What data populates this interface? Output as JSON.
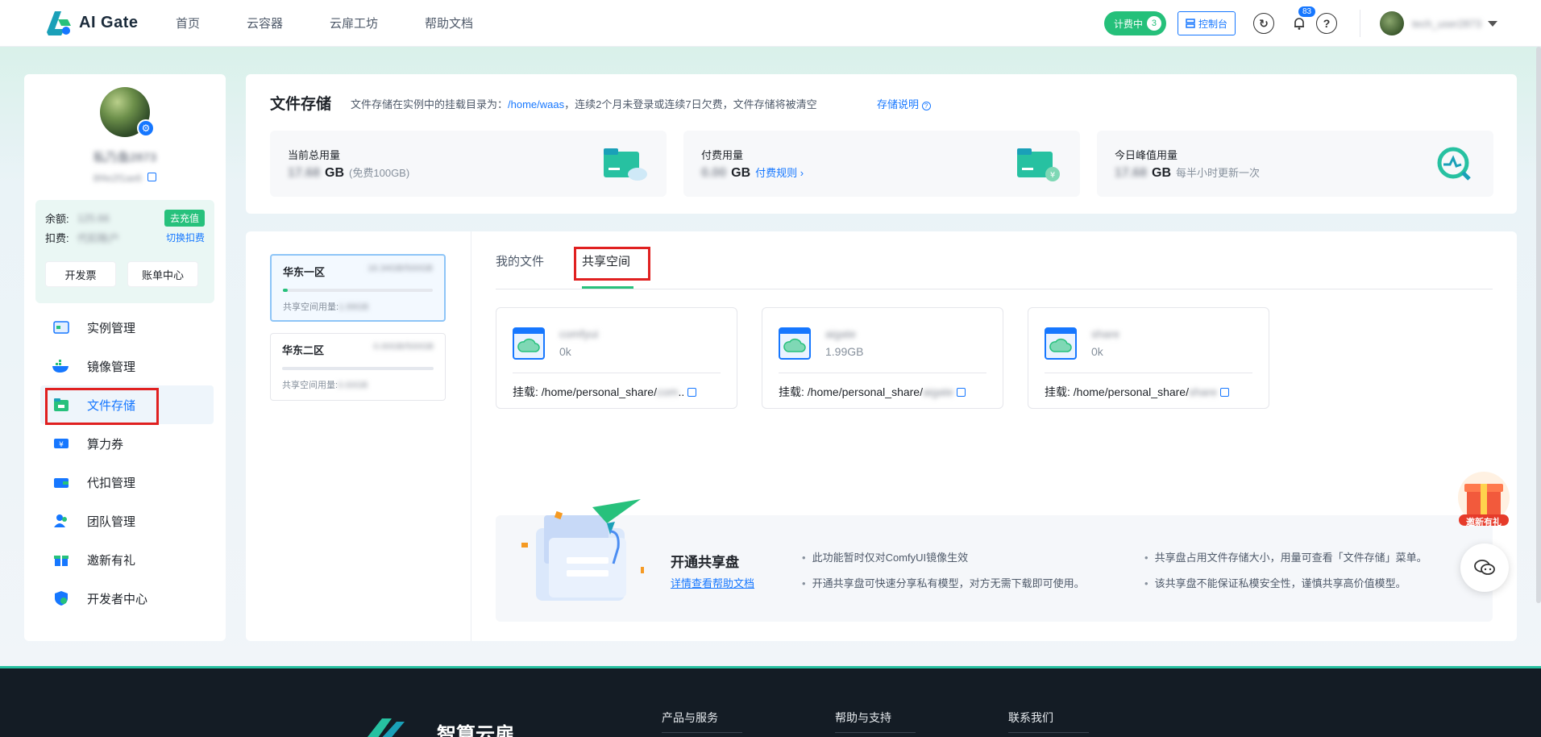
{
  "header": {
    "logo_text": "AI Gate",
    "nav": [
      "首页",
      "云容器",
      "云扉工坊",
      "帮助文档"
    ],
    "billing_label": "计费中",
    "billing_count": "3",
    "console_label": "控制台",
    "notification_count": "83",
    "help_glyph": "?",
    "username": "tech_user2873"
  },
  "sidebar": {
    "name": "私乃鱼2873",
    "user_id": "8f4e2f1ae6",
    "balance_label": "余额:",
    "balance_value": "125.66",
    "recharge_label": "去充值",
    "deduct_label": "扣费:",
    "deduct_value": "代扣账户",
    "switch_label": "切换扣费",
    "invoice_label": "开发票",
    "bill_center_label": "账单中心",
    "menu": [
      {
        "label": "实例管理",
        "icon": "instance-icon"
      },
      {
        "label": "镜像管理",
        "icon": "docker-icon"
      },
      {
        "label": "文件存储",
        "icon": "file-storage-icon"
      },
      {
        "label": "算力券",
        "icon": "coupon-icon"
      },
      {
        "label": "代扣管理",
        "icon": "wallet-icon"
      },
      {
        "label": "团队管理",
        "icon": "team-icon"
      },
      {
        "label": "邀新有礼",
        "icon": "gift-icon"
      },
      {
        "label": "开发者中心",
        "icon": "developer-icon"
      }
    ]
  },
  "storage": {
    "title": "文件存储",
    "desc_prefix": "文件存储在实例中的挂载目录为：",
    "mount_path": "/home/waas",
    "desc_suffix": "，连续2个月未登录或连续7日欠费，文件存储将被清空",
    "help_link": "存储说明",
    "stats": [
      {
        "label": "当前总用量",
        "value": "17.68",
        "unit": "GB",
        "note": "(免费100GB)",
        "link": ""
      },
      {
        "label": "付费用量",
        "value": "0.00",
        "unit": "GB",
        "note": "",
        "link": "付费规则"
      },
      {
        "label": "今日峰值用量",
        "value": "17.68",
        "unit": "GB",
        "note": "每半小时更新一次",
        "link": ""
      }
    ]
  },
  "regions": [
    {
      "name": "华东一区",
      "amount": "16.34GB/500GB",
      "usage_label": "共享空间用量:",
      "usage_value": "1.99GB",
      "fill": 0.03
    },
    {
      "name": "华东二区",
      "amount": "0.00GB/500GB",
      "usage_label": "共享空间用量:",
      "usage_value": "0.00GB",
      "fill": 0.0
    }
  ],
  "tabs": [
    "我的文件",
    "共享空间"
  ],
  "shared_files": [
    {
      "name": "comfyui",
      "size": "0k",
      "mount_label": "挂载:",
      "mount_prefix": "/home/personal_share/",
      "mount_tail": "com",
      "ellipsis": ".."
    },
    {
      "name": "aigate",
      "size": "1.99GB",
      "mount_label": "挂载:",
      "mount_prefix": "/home/personal_share/",
      "mount_tail": "aigate",
      "ellipsis": ""
    },
    {
      "name": "share",
      "size": "0k",
      "mount_label": "挂载:",
      "mount_prefix": "/home/personal_share/",
      "mount_tail": "share",
      "ellipsis": ""
    }
  ],
  "promo": {
    "title": "开通共享盘",
    "link": "详情查看帮助文档",
    "bullets": [
      "此功能暂时仅对ComfyUI镜像生效",
      "开通共享盘可快速分享私有模型，对方无需下载即可使用。",
      "共享盘占用文件存储大小，用量可查看「文件存储」菜单。",
      "该共享盘不能保证私模安全性，谨慎共享高价值模型。"
    ]
  },
  "float": {
    "gift_label": "邀新有礼"
  },
  "footer": {
    "brand": "智算云扉",
    "columns": [
      "产品与服务",
      "帮助与支持",
      "联系我们"
    ]
  },
  "colors": {
    "accent": "#1677ff",
    "green": "#27c17c",
    "highlight": "#e02020"
  }
}
